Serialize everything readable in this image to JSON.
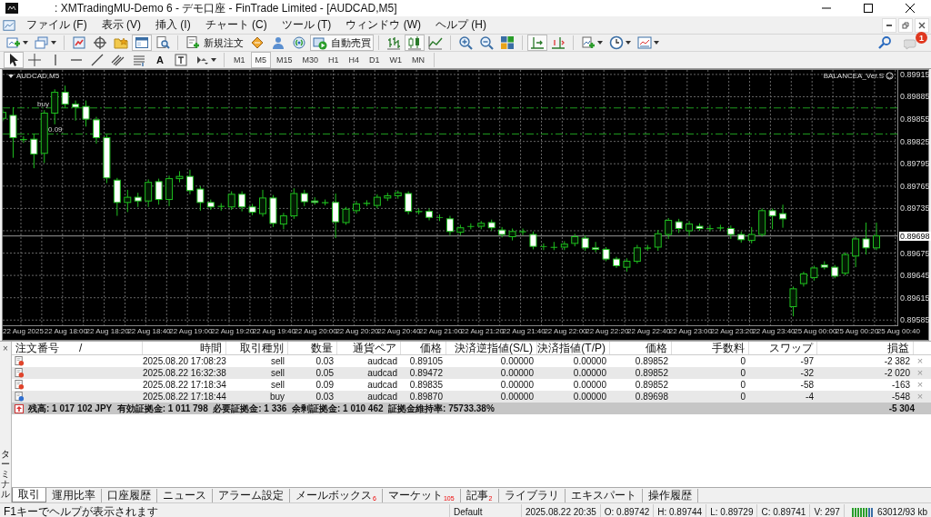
{
  "window": {
    "title": ": XMTradingMU-Demo 6 - デモ口座 - FinTrade Limited - [AUDCAD,M5]"
  },
  "menu": [
    {
      "label": "ファイル (F)"
    },
    {
      "label": "表示 (V)"
    },
    {
      "label": "挿入 (I)"
    },
    {
      "label": "チャート (C)"
    },
    {
      "label": "ツール (T)"
    },
    {
      "label": "ウィンドウ (W)"
    },
    {
      "label": "ヘルプ (H)"
    }
  ],
  "toolbar": {
    "panels": [
      {
        "on": false
      },
      {
        "on": false
      },
      {
        "on": false
      },
      {
        "on": true
      },
      {
        "on": false
      }
    ],
    "new_order": {
      "label": "新規注文"
    },
    "auto_trading": {
      "label": "自動売買",
      "on": true
    },
    "chart_types": [
      {
        "selected": false
      },
      {
        "selected": true
      },
      {
        "selected": false
      }
    ],
    "auto_scroll": {
      "on": true
    },
    "chart_shift": {
      "on": false
    },
    "notification_badge": "1"
  },
  "drawing_tools": [
    {
      "kind": "cursor",
      "selected": true
    },
    {
      "kind": "crosshair",
      "selected": false
    },
    {
      "kind": "vline",
      "selected": false
    },
    {
      "kind": "hline",
      "selected": false
    },
    {
      "kind": "trendline",
      "selected": false
    },
    {
      "kind": "channel",
      "selected": false
    },
    {
      "kind": "fibo",
      "selected": false
    },
    {
      "kind": "text",
      "label": "A",
      "selected": false
    },
    {
      "kind": "label",
      "selected": false
    },
    {
      "kind": "arrows",
      "selected": false
    }
  ],
  "timeframes": [
    {
      "label": "M1",
      "selected": false
    },
    {
      "label": "M5",
      "selected": true
    },
    {
      "label": "M15",
      "selected": false
    },
    {
      "label": "M30",
      "selected": false
    },
    {
      "label": "H1",
      "selected": false
    },
    {
      "label": "H4",
      "selected": false
    },
    {
      "label": "D1",
      "selected": false
    },
    {
      "label": "W1",
      "selected": false
    },
    {
      "label": "MN",
      "selected": false
    }
  ],
  "chart": {
    "symbol": "AUDCAD,M5",
    "expert": "BALANCEA_Ver.S",
    "order_labels": [
      {
        "text": "buy"
      },
      {
        "text": "0.09"
      }
    ],
    "current_price": "0.89698",
    "chart_data": {
      "type": "candlestick",
      "ylim": [
        0.89578,
        0.89921
      ],
      "grid": true,
      "ref_lines": [
        {
          "axis": "y",
          "value": 0.8987,
          "color": "#1f9a1f"
        },
        {
          "axis": "y",
          "value": 0.89835,
          "color": "#1f9a1f"
        },
        {
          "axis": "y",
          "value": 0.89698,
          "color": "#999999"
        }
      ],
      "yticks": [
        {
          "value": 0.89915,
          "label": "0.89915"
        },
        {
          "value": 0.89885,
          "label": "0.89885"
        },
        {
          "value": 0.89855,
          "label": "0.89855"
        },
        {
          "value": 0.89825,
          "label": "0.89825"
        },
        {
          "value": 0.89795,
          "label": "0.89795"
        },
        {
          "value": 0.89765,
          "label": "0.89765"
        },
        {
          "value": 0.89735,
          "label": "0.89735"
        },
        {
          "value": 0.89675,
          "label": "0.89675"
        },
        {
          "value": 0.89645,
          "label": "0.89645"
        },
        {
          "value": 0.89615,
          "label": "0.89615"
        },
        {
          "value": 0.89585,
          "label": "0.89585"
        }
      ],
      "categories": [
        null,
        null,
        null,
        null,
        null,
        null,
        null,
        null,
        null,
        null,
        null,
        null,
        null,
        null,
        null,
        null,
        null,
        null,
        null,
        null,
        null,
        null,
        null,
        null,
        null,
        null,
        null,
        null,
        null,
        null,
        null,
        null,
        null,
        null,
        null,
        null,
        null,
        null,
        null,
        null,
        null,
        null,
        null,
        null,
        null,
        null,
        null,
        null,
        null,
        null,
        null,
        null,
        null,
        null,
        null,
        null,
        null,
        null,
        null,
        null,
        null,
        null,
        null,
        null,
        null,
        null,
        null,
        null,
        null,
        null,
        null,
        null,
        null,
        null,
        null,
        null,
        null,
        null,
        null,
        null,
        null,
        null,
        null,
        null,
        null
      ],
      "ohlc": [
        [
          0.89856,
          0.89868,
          0.89852,
          0.89864
        ],
        [
          0.8986,
          0.89871,
          0.89803,
          0.8983
        ],
        [
          0.89828,
          0.89832,
          0.89823,
          0.89827
        ],
        [
          0.89828,
          0.89835,
          0.89789,
          0.89808
        ],
        [
          0.89809,
          0.89867,
          0.89796,
          0.89863
        ],
        [
          0.89863,
          0.89895,
          0.89848,
          0.89891
        ],
        [
          0.89891,
          0.899,
          0.8987,
          0.89875
        ],
        [
          0.89875,
          0.8988,
          0.89853,
          0.89871
        ],
        [
          0.89872,
          0.8988,
          0.89845,
          0.89855
        ],
        [
          0.89854,
          0.89858,
          0.89822,
          0.8983
        ],
        [
          0.8983,
          0.89834,
          0.89769,
          0.89776
        ],
        [
          0.89773,
          0.89776,
          0.89725,
          0.89743
        ],
        [
          0.89743,
          0.8976,
          0.8973,
          0.8975
        ],
        [
          0.8975,
          0.89756,
          0.89737,
          0.89745
        ],
        [
          0.89745,
          0.89774,
          0.89737,
          0.8977
        ],
        [
          0.89771,
          0.89775,
          0.8974,
          0.89747
        ],
        [
          0.89747,
          0.89779,
          0.89738,
          0.89775
        ],
        [
          0.89775,
          0.89785,
          0.8977,
          0.89778
        ],
        [
          0.89778,
          0.89787,
          0.89754,
          0.89759
        ],
        [
          0.89761,
          0.89765,
          0.89732,
          0.89743
        ],
        [
          0.89743,
          0.89747,
          0.89733,
          0.89737
        ],
        [
          0.89738,
          0.89742,
          0.89732,
          0.89738
        ],
        [
          0.89737,
          0.89758,
          0.89733,
          0.89754
        ],
        [
          0.89754,
          0.89758,
          0.89731,
          0.89737
        ],
        [
          0.89737,
          0.89741,
          0.89726,
          0.8973
        ],
        [
          0.89728,
          0.8976,
          0.89724,
          0.89749
        ],
        [
          0.89749,
          0.89753,
          0.8971,
          0.89715
        ],
        [
          0.89714,
          0.89729,
          0.89707,
          0.89725
        ],
        [
          0.89725,
          0.89762,
          0.89721,
          0.89755
        ],
        [
          0.89755,
          0.8976,
          0.89738,
          0.89744
        ],
        [
          0.89745,
          0.8975,
          0.8974,
          0.89743
        ],
        [
          0.89743,
          0.89747,
          0.89739,
          0.89743
        ],
        [
          0.89743,
          0.89755,
          0.89695,
          0.89717
        ],
        [
          0.89716,
          0.89737,
          0.89713,
          0.89734
        ],
        [
          0.89732,
          0.89745,
          0.89728,
          0.89741
        ],
        [
          0.89742,
          0.89746,
          0.89738,
          0.89742
        ],
        [
          0.89739,
          0.89754,
          0.89735,
          0.8975
        ],
        [
          0.89749,
          0.89756,
          0.89745,
          0.89752
        ],
        [
          0.89752,
          0.89759,
          0.89748,
          0.89756
        ],
        [
          0.89755,
          0.89758,
          0.89727,
          0.89731
        ],
        [
          0.89731,
          0.89735,
          0.89727,
          0.89731
        ],
        [
          0.89731,
          0.89735,
          0.89719,
          0.89723
        ],
        [
          0.89723,
          0.89727,
          0.89718,
          0.89723
        ],
        [
          0.89721,
          0.89725,
          0.89699,
          0.89704
        ],
        [
          0.89703,
          0.89713,
          0.89699,
          0.89709
        ],
        [
          0.89711,
          0.89715,
          0.89707,
          0.89711
        ],
        [
          0.89711,
          0.89718,
          0.89707,
          0.89715
        ],
        [
          0.89716,
          0.8972,
          0.89705,
          0.89709
        ],
        [
          0.89706,
          0.8971,
          0.89696,
          0.897
        ],
        [
          0.89697,
          0.89708,
          0.89692,
          0.89704
        ],
        [
          0.89704,
          0.89708,
          0.89699,
          0.89704
        ],
        [
          0.897,
          0.89704,
          0.8968,
          0.89684
        ],
        [
          0.89684,
          0.89688,
          0.89679,
          0.89684
        ],
        [
          0.89683,
          0.8969,
          0.89679,
          0.89683
        ],
        [
          0.89683,
          0.89691,
          0.89679,
          0.89687
        ],
        [
          0.89688,
          0.89701,
          0.89684,
          0.89697
        ],
        [
          0.89695,
          0.89699,
          0.89678,
          0.89682
        ],
        [
          0.89682,
          0.8969,
          0.89676,
          0.8968
        ],
        [
          0.8968,
          0.89683,
          0.89664,
          0.89667
        ],
        [
          0.89667,
          0.8967,
          0.89655,
          0.89658
        ],
        [
          0.89656,
          0.89668,
          0.8965,
          0.89664
        ],
        [
          0.89664,
          0.89686,
          0.89661,
          0.89682
        ],
        [
          0.89682,
          0.89686,
          0.89678,
          0.89682
        ],
        [
          0.89683,
          0.89706,
          0.89678,
          0.89701
        ],
        [
          0.897,
          0.89722,
          0.89694,
          0.89719
        ],
        [
          0.89717,
          0.89721,
          0.89702,
          0.89708
        ],
        [
          0.89705,
          0.89718,
          0.89698,
          0.89714
        ],
        [
          0.89711,
          0.89715,
          0.89705,
          0.89708
        ],
        [
          0.89708,
          0.89713,
          0.89704,
          0.89708
        ],
        [
          0.89709,
          0.89713,
          0.89705,
          0.89709
        ],
        [
          0.89708,
          0.89712,
          0.89694,
          0.897
        ],
        [
          0.897,
          0.89704,
          0.89689,
          0.89693
        ],
        [
          0.89692,
          0.8971,
          0.89688,
          0.897
        ],
        [
          0.897,
          0.89735,
          0.89697,
          0.89732
        ],
        [
          0.89732,
          0.89735,
          0.89707,
          0.89725
        ],
        [
          0.89728,
          0.8974,
          0.89709,
          0.89721
        ],
        [
          0.89603,
          0.8963,
          0.8959,
          0.89627
        ],
        [
          0.89634,
          0.8965,
          0.8963,
          0.89647
        ],
        [
          0.89642,
          0.89658,
          0.89638,
          0.89655
        ],
        [
          0.89659,
          0.89664,
          0.89653,
          0.89656
        ],
        [
          0.89656,
          0.89659,
          0.89641,
          0.89644
        ],
        [
          0.89648,
          0.89676,
          0.89645,
          0.89673
        ],
        [
          0.89671,
          0.89697,
          0.89656,
          0.89694
        ],
        [
          0.89694,
          0.89716,
          0.89673,
          0.89682
        ],
        [
          0.89682,
          0.89716,
          0.89679,
          0.89698
        ]
      ]
    },
    "time_ticks": [
      "22 Aug 2025",
      "22 Aug 18:00",
      "22 Aug 18:20",
      "22 Aug 18:40",
      "22 Aug 19:00",
      "22 Aug 19:20",
      "22 Aug 19:40",
      "22 Aug 20:00",
      "22 Aug 20:20",
      "22 Aug 20:40",
      "22 Aug 21:00",
      "22 Aug 21:20",
      "22 Aug 21:40",
      "22 Aug 22:00",
      "22 Aug 22:20",
      "22 Aug 22:40",
      "22 Aug 23:00",
      "22 Aug 23:20",
      "22 Aug 23:40",
      "25 Aug 00:00",
      "25 Aug 00:20",
      "25 Aug 00:40"
    ]
  },
  "terminal": {
    "title": "ターミナル",
    "close": "×",
    "columns": [
      {
        "label": "注文番号",
        "sort_mark": "/"
      },
      {
        "label": "時間"
      },
      {
        "label": "取引種別"
      },
      {
        "label": "数量"
      },
      {
        "label": "通貨ペア"
      },
      {
        "label": "価格"
      },
      {
        "label": "決済逆指値(S/L)"
      },
      {
        "label": "決済指値(T/P)"
      },
      {
        "label": "価格"
      },
      {
        "label": "手数料"
      },
      {
        "label": "スワップ"
      },
      {
        "label": "損益"
      }
    ],
    "rows": [
      {
        "kind": "sell",
        "cells": [
          "",
          "2025.08.20 17:08:23",
          "sell",
          "0.03",
          "audcad",
          "0.89105",
          "0.00000",
          "0.00000",
          "0.89852",
          "0",
          "-97",
          "-2 382"
        ],
        "close": "×"
      },
      {
        "kind": "sell",
        "cells": [
          "",
          "2025.08.22 16:32:38",
          "sell",
          "0.05",
          "audcad",
          "0.89472",
          "0.00000",
          "0.00000",
          "0.89852",
          "0",
          "-32",
          "-2 020"
        ],
        "close": "×"
      },
      {
        "kind": "sell",
        "cells": [
          "",
          "2025.08.22 17:18:34",
          "sell",
          "0.09",
          "audcad",
          "0.89835",
          "0.00000",
          "0.00000",
          "0.89852",
          "0",
          "-58",
          "-163"
        ],
        "close": "×"
      },
      {
        "kind": "buy",
        "cells": [
          "",
          "2025.08.22 17:18:44",
          "buy",
          "0.03",
          "audcad",
          "0.89870",
          "0.00000",
          "0.00000",
          "0.89698",
          "0",
          "-4",
          "-548"
        ],
        "close": "×"
      }
    ],
    "summary": {
      "text": "残高: 1 017 102 JPY  有効証拠金: 1 011 798  必要証拠金: 1 336  余剰証拠金: 1 010 462  証拠金維持率: 75733.38%",
      "total": "-5 304"
    },
    "tabs": [
      {
        "label": "取引",
        "selected": true
      },
      {
        "label": "運用比率",
        "selected": false
      },
      {
        "label": "口座履歴",
        "selected": false
      },
      {
        "label": "ニュース",
        "selected": false
      },
      {
        "label": "アラーム設定",
        "selected": false
      },
      {
        "label": "メールボックス",
        "badge": "6",
        "selected": false
      },
      {
        "label": "マーケット",
        "badge": "105",
        "selected": false
      },
      {
        "label": "記事",
        "badge": "2",
        "selected": false
      },
      {
        "label": "ライブラリ",
        "selected": false
      },
      {
        "label": "エキスパート",
        "selected": false
      },
      {
        "label": "操作履歴",
        "selected": false
      }
    ]
  },
  "status_bar": {
    "help": "F1キーでヘルプが表示されます",
    "profile": "Default",
    "time": "2025.08.22 20:35",
    "open": "O: 0.89742",
    "high": "H: 0.89744",
    "low": "L: 0.89729",
    "close": "C: 0.89741",
    "volume": "V: 297",
    "traffic": "63012/93 kb"
  }
}
